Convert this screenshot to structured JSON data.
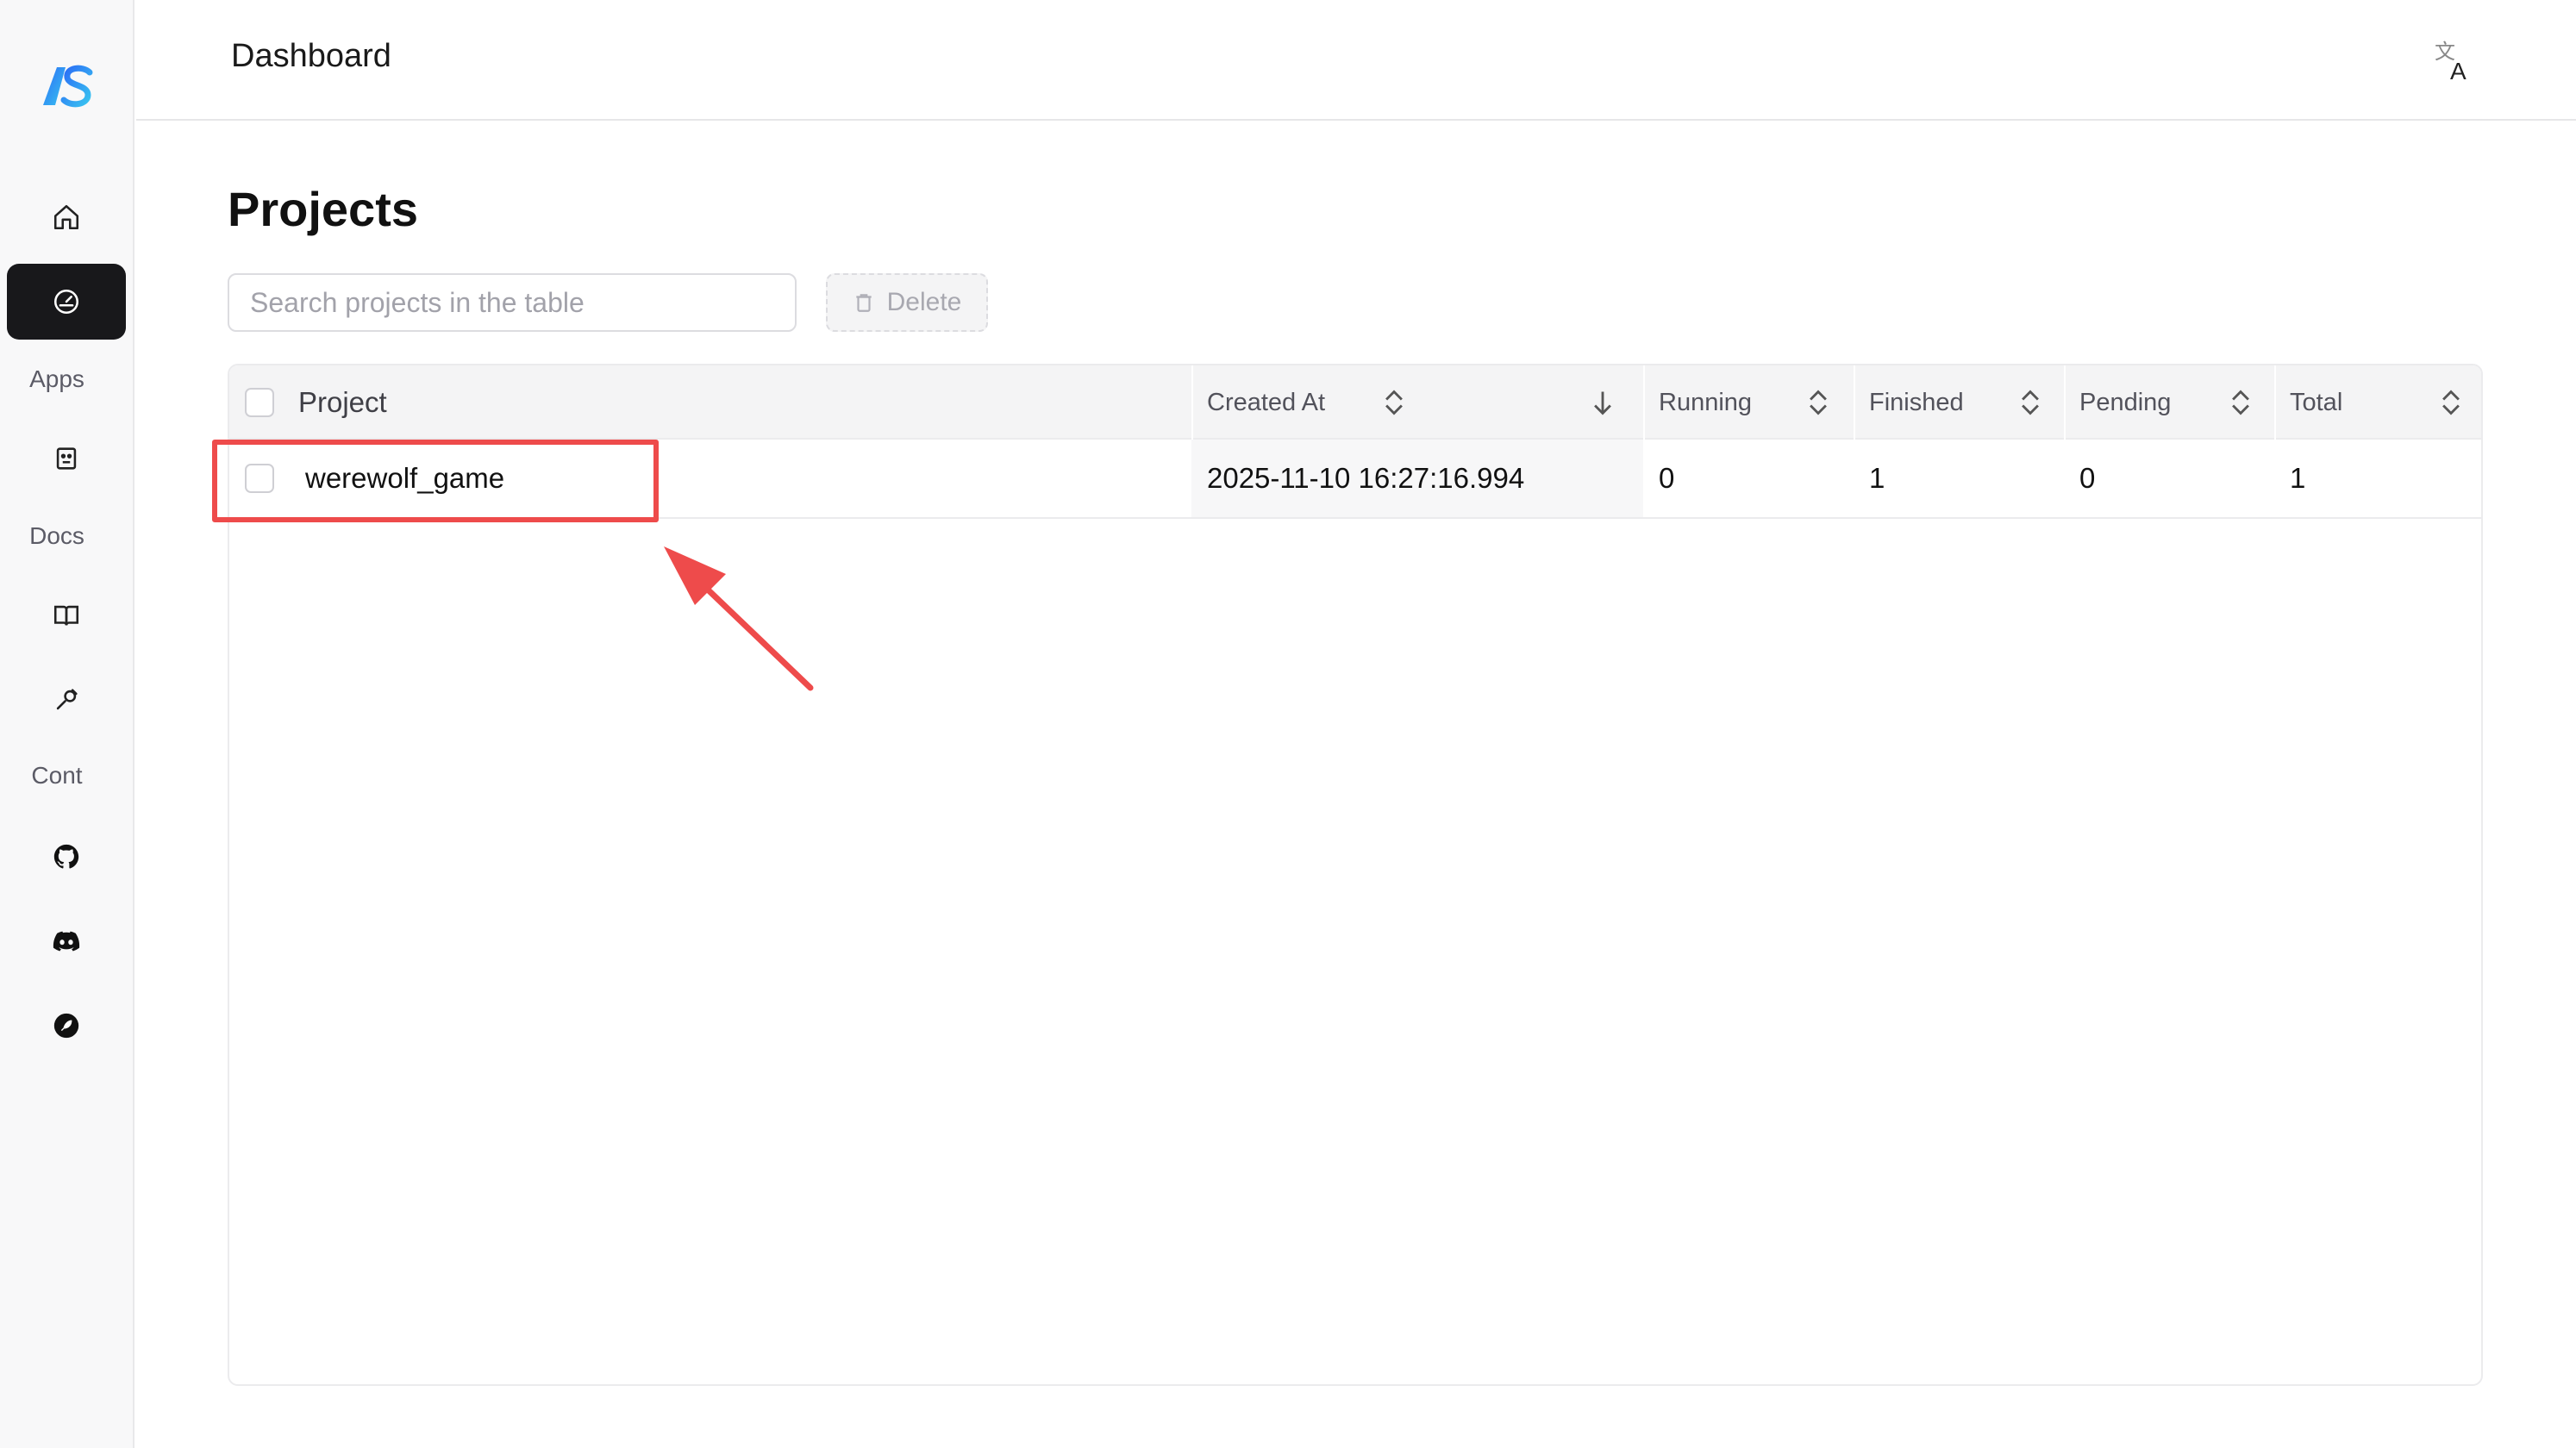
{
  "sidebar": {
    "items": [
      {
        "icon": "home-icon"
      },
      {
        "icon": "gauge-icon",
        "active": true
      },
      {
        "label": "Apps"
      },
      {
        "icon": "robot-icon"
      },
      {
        "label": "Docs"
      },
      {
        "icon": "book-icon"
      },
      {
        "icon": "tool-icon"
      },
      {
        "label": "Cont"
      },
      {
        "icon": "github-icon"
      },
      {
        "icon": "discord-icon"
      },
      {
        "icon": "feather-icon"
      }
    ],
    "apps_label": "Apps",
    "docs_label": "Docs",
    "cont_label": "Cont"
  },
  "header": {
    "title": "Dashboard",
    "translate_icon": "translate-icon"
  },
  "main": {
    "title": "Projects",
    "search": {
      "placeholder": "Search projects in the table",
      "value": ""
    },
    "delete_label": "Delete"
  },
  "table": {
    "columns": [
      "Project",
      "Created At",
      "Running",
      "Finished",
      "Pending",
      "Total"
    ],
    "sort_state": {
      "Created At": "descending"
    },
    "rows": [
      {
        "project": "werewolf_game",
        "created_at": "2025-11-10 16:27:16.994",
        "running": "0",
        "finished": "1",
        "pending": "0",
        "total": "1"
      }
    ]
  },
  "annotation": {
    "color": "#ee4b4b"
  },
  "colors": {
    "active_nav": "#18181b",
    "logo_gradient": [
      "#2b6cf6",
      "#39c5f0"
    ]
  }
}
